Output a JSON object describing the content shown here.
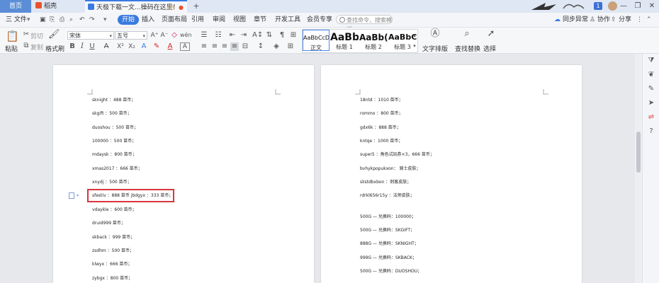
{
  "titlebar": {
    "tabs": [
      {
        "label": "首页"
      },
      {
        "label": "稻壳"
      },
      {
        "label": "天极下载一文...操码在这里！"
      }
    ],
    "new_tab": "+",
    "badge": "1",
    "win": {
      "min": "—",
      "max": "❐",
      "close": "✕"
    }
  },
  "menubar": {
    "file": "三 文件",
    "items": [
      "开始",
      "插入",
      "页面布局",
      "引用",
      "审阅",
      "视图",
      "章节",
      "开发工具",
      "会员专享"
    ],
    "search_placeholder": "查找命令、搜索模板",
    "right": {
      "sync": "同步异常",
      "collab": "协作",
      "share": "分享"
    }
  },
  "ribbon": {
    "paste": "粘贴",
    "cut": "剪切",
    "copy": "复制",
    "format_painter": "格式刷",
    "font_name": "宋体",
    "font_size": "五号",
    "styles": [
      {
        "preview": "AaBbCcDd",
        "label": "正文"
      },
      {
        "preview": "AaBb",
        "label": "标题 1"
      },
      {
        "preview": "AaBb(",
        "label": "标题 2"
      },
      {
        "preview": "AaBbC",
        "label": "标题 3"
      }
    ],
    "text_layout": "文字排版",
    "find_replace": "查找替换",
    "select": "选择"
  },
  "document": {
    "left_lines": [
      "sknight ：488 苗币；",
      "skgift ：500 苗币；",
      "duoshou ：500 苗币；",
      "100000 ：500 苗币；",
      "mdaysk ：800 苗币；",
      "xmas2017 ：666 苗币；",
      "xnydj ：500 苗币；",
      "sfestiv ：888 苗币 jbdgyx ：333 苗币；",
      "vdaykle ：600 苗币；",
      "druid999 苗币；",
      "skback ：999 苗币；",
      "zsdhm ：500 苗币；",
      "klwyx ：666 苗币；",
      "zybgx ：800 苗币；"
    ],
    "right_lines": [
      "18ntd ：1010 苗币；",
      "rommo ：800 苗币；",
      "gdx6k ：888 苗币；",
      "kntqe ：1000 苗币；",
      "super5 ：角色试玩券×3，666 苗币；",
      "bvhykpopukxon：  骑士皮肤；",
      "slistdbxbon ：刺客皮肤；",
      "rdrkl656r15y ：法师皮肤；",
      "500G — 兑换码：100000；",
      "500G — 兑换码：SKGIFT；",
      "888G — 兑换码：SKNIGHT；",
      "999G — 兑换码：SKBACK；",
      "500G — 兑换码：DUOSHOU；"
    ]
  },
  "colors": {
    "accent": "#3a7be0",
    "highlight_box": "#d9363e",
    "home_tab": "#5b8ed6"
  }
}
